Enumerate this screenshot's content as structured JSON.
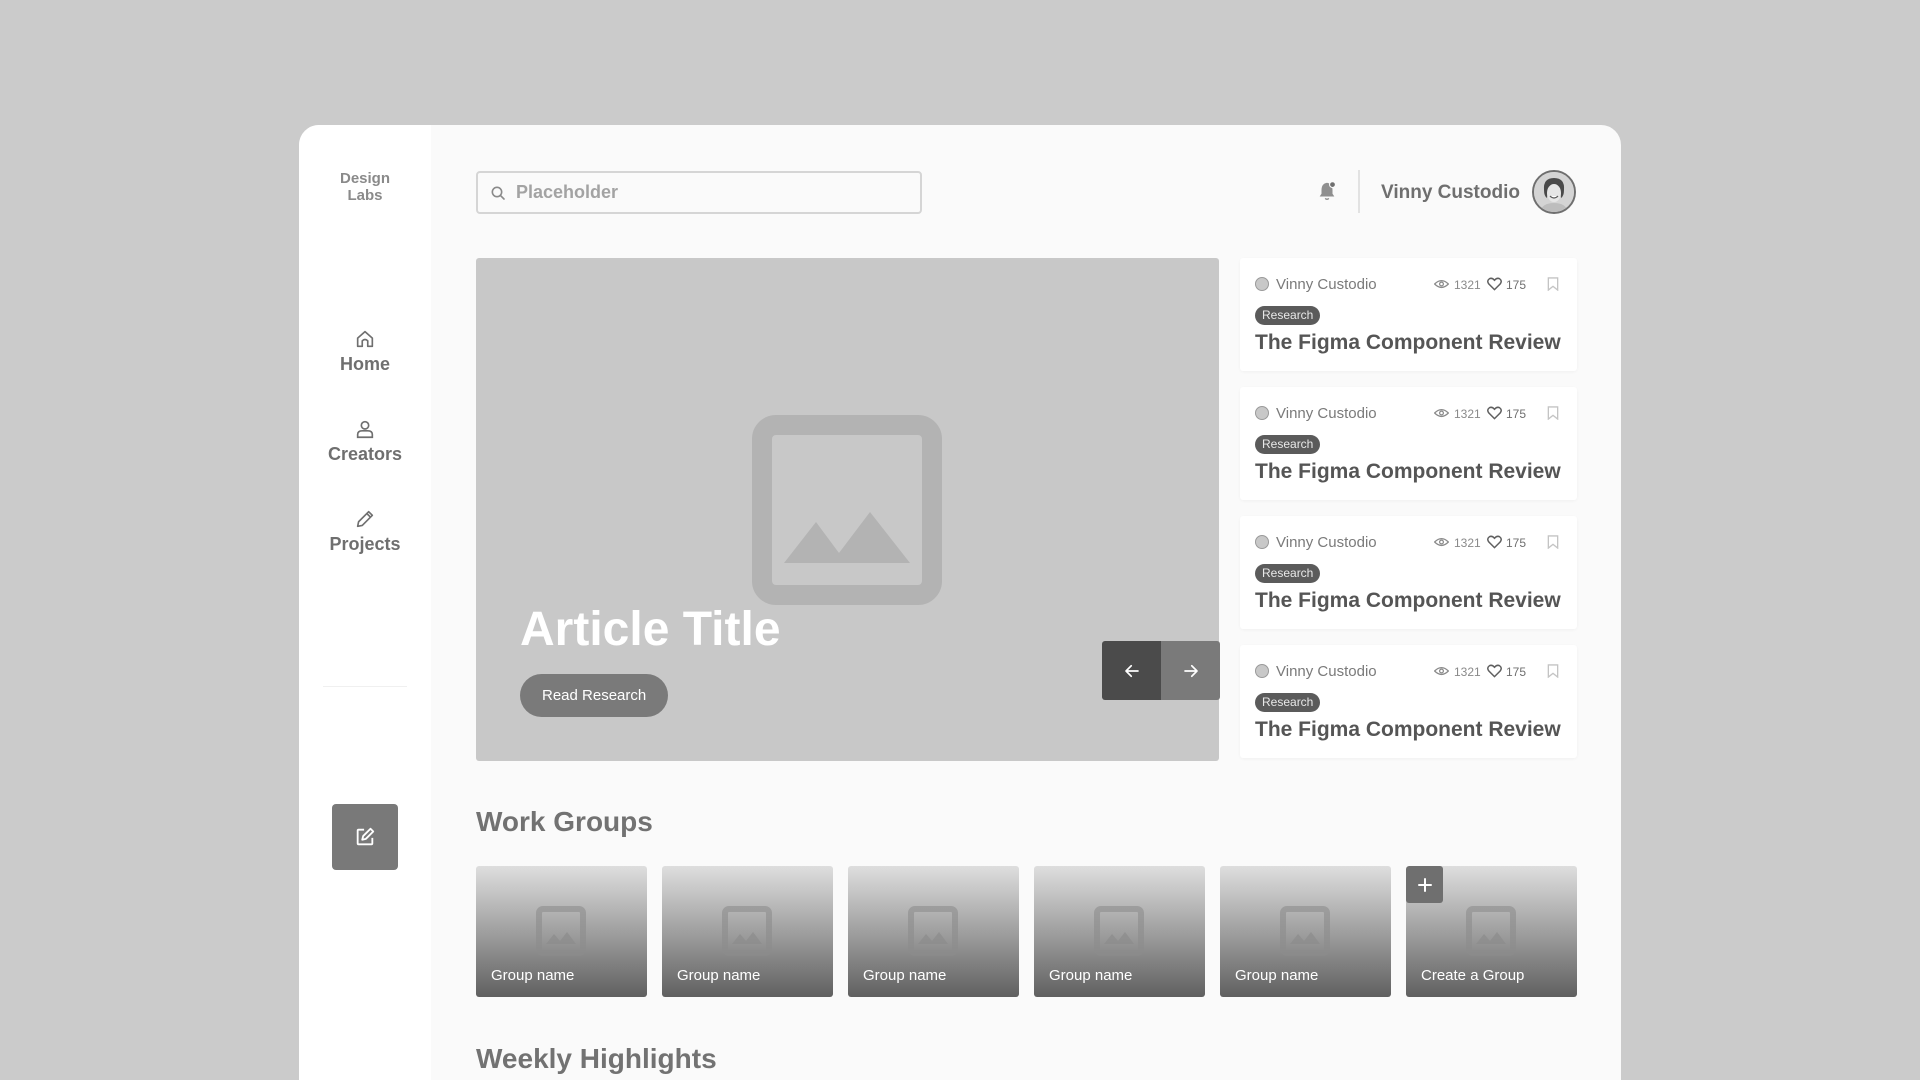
{
  "sidebar": {
    "logo": "Design\nLabs",
    "logo_line1": "Design",
    "logo_line2": "Labs",
    "items": [
      {
        "label": "Home",
        "icon": "home-icon"
      },
      {
        "label": "Creators",
        "icon": "user-icon"
      },
      {
        "label": "Projects",
        "icon": "pencil-icon"
      }
    ],
    "compose_icon": "edit-square-icon"
  },
  "header": {
    "search_placeholder": "Placeholder",
    "search_value": "",
    "notification_icon": "bell-icon",
    "has_notification": true,
    "user_name": "Vinny Custodio"
  },
  "hero": {
    "title": "Article Title",
    "button_label": "Read Research",
    "prev_icon": "arrow-left-icon",
    "next_icon": "arrow-right-icon"
  },
  "articles": [
    {
      "author": "Vinny Custodio",
      "views": "1321",
      "likes": "175",
      "tag": "Research",
      "title": "The Figma Component Review"
    },
    {
      "author": "Vinny Custodio",
      "views": "1321",
      "likes": "175",
      "tag": "Research",
      "title": "The Figma Component Review"
    },
    {
      "author": "Vinny Custodio",
      "views": "1321",
      "likes": "175",
      "tag": "Research",
      "title": "The Figma Component Review"
    },
    {
      "author": "Vinny Custodio",
      "views": "1321",
      "likes": "175",
      "tag": "Research",
      "title": "The Figma Component Review"
    }
  ],
  "work_groups": {
    "title": "Work Groups",
    "groups": [
      {
        "name": "Group name"
      },
      {
        "name": "Group name"
      },
      {
        "name": "Group name"
      },
      {
        "name": "Group name"
      },
      {
        "name": "Group name"
      }
    ],
    "create_label": "Create a Group"
  },
  "weekly_highlights": {
    "title": "Weekly Highlights"
  },
  "colors": {
    "background": "#cbcbcb",
    "panel": "#fafafa",
    "sidebar": "#ffffff",
    "hero": "#c8c8c8",
    "dark_button": "#4b4b4b",
    "mid_button": "#7a7a7a",
    "tag": "#5b5b5b",
    "text": "#6f6f6f"
  }
}
